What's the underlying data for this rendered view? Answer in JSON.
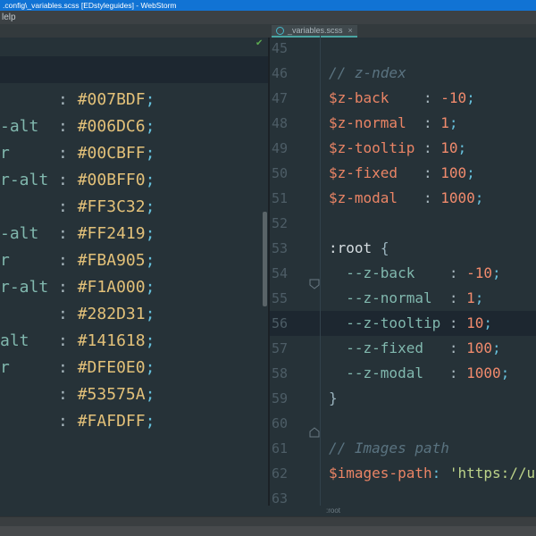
{
  "window": {
    "title": ".config\\_variables.scss [EDstyleguides] - WebStorm",
    "menu_fragment": "lelp"
  },
  "tab_bar": {
    "active_tab": {
      "label": "_variables.scss",
      "close_glyph": "×",
      "icon": "scss-file-icon"
    }
  },
  "left_editor": {
    "lines": [
      {
        "name": "",
        "colon": ":",
        "value": "#007BDF",
        "semi": ";"
      },
      {
        "name": "-alt",
        "colon": ":",
        "value": "#006DC6",
        "semi": ";"
      },
      {
        "name": "r",
        "colon": ":",
        "value": "#00CBFF",
        "semi": ";"
      },
      {
        "name": "r-alt",
        "colon": ":",
        "value": "#00BFF0",
        "semi": ";"
      },
      {
        "name": "",
        "colon": ":",
        "value": "#FF3C32",
        "semi": ";"
      },
      {
        "name": "-alt",
        "colon": ":",
        "value": "#FF2419",
        "semi": ";"
      },
      {
        "name": "r",
        "colon": ":",
        "value": "#FBA905",
        "semi": ";"
      },
      {
        "name": "r-alt",
        "colon": ":",
        "value": "#F1A000",
        "semi": ";"
      },
      {
        "name": "",
        "colon": ":",
        "value": "#282D31",
        "semi": ";"
      },
      {
        "name": "alt",
        "colon": ":",
        "value": "#141618",
        "semi": ";"
      },
      {
        "name": "r",
        "colon": ":",
        "value": "#DFE0E0",
        "semi": ";"
      },
      {
        "name": "",
        "colon": ":",
        "value": "#53575A",
        "semi": ";"
      },
      {
        "name": "",
        "colon": ":",
        "value": "#FAFDFF",
        "semi": ";"
      }
    ],
    "inspection_ok_glyph": "✔"
  },
  "right_editor": {
    "highlighted_line": "56",
    "fold_markers": [
      {
        "line": "53",
        "type": "open"
      },
      {
        "line": "59",
        "type": "close"
      }
    ],
    "breadcrumb": ":root",
    "lines": [
      {
        "num": "45",
        "tokens": []
      },
      {
        "num": "46",
        "tokens": [
          {
            "c": "comment",
            "t": "// z-ndex"
          }
        ]
      },
      {
        "num": "47",
        "tokens": [
          {
            "c": "var",
            "t": "$z-back"
          },
          {
            "c": "colon",
            "t": "    : "
          },
          {
            "c": "num",
            "t": "-10"
          },
          {
            "c": "semi",
            "t": ";"
          }
        ]
      },
      {
        "num": "48",
        "tokens": [
          {
            "c": "var",
            "t": "$z-normal"
          },
          {
            "c": "colon",
            "t": "  : "
          },
          {
            "c": "num",
            "t": "1"
          },
          {
            "c": "semi",
            "t": ";"
          }
        ]
      },
      {
        "num": "49",
        "tokens": [
          {
            "c": "var",
            "t": "$z-tooltip"
          },
          {
            "c": "colon",
            "t": " : "
          },
          {
            "c": "num",
            "t": "10"
          },
          {
            "c": "semi",
            "t": ";"
          }
        ]
      },
      {
        "num": "50",
        "tokens": [
          {
            "c": "var",
            "t": "$z-fixed"
          },
          {
            "c": "colon",
            "t": "   : "
          },
          {
            "c": "num",
            "t": "100"
          },
          {
            "c": "semi",
            "t": ";"
          }
        ]
      },
      {
        "num": "51",
        "tokens": [
          {
            "c": "var",
            "t": "$z-modal"
          },
          {
            "c": "colon",
            "t": "   : "
          },
          {
            "c": "num",
            "t": "1000"
          },
          {
            "c": "semi",
            "t": ";"
          }
        ]
      },
      {
        "num": "52",
        "tokens": []
      },
      {
        "num": "53",
        "tokens": [
          {
            "c": "selector",
            "t": ":root"
          },
          {
            "c": "plain",
            "t": " "
          },
          {
            "c": "brace",
            "t": "{"
          }
        ]
      },
      {
        "num": "54",
        "tokens": [
          {
            "c": "plain",
            "t": "  "
          },
          {
            "c": "prop",
            "t": "--z-back"
          },
          {
            "c": "colon",
            "t": "    : "
          },
          {
            "c": "num",
            "t": "-10"
          },
          {
            "c": "semi",
            "t": ";"
          }
        ]
      },
      {
        "num": "55",
        "tokens": [
          {
            "c": "plain",
            "t": "  "
          },
          {
            "c": "prop",
            "t": "--z-normal"
          },
          {
            "c": "colon",
            "t": "  : "
          },
          {
            "c": "num",
            "t": "1"
          },
          {
            "c": "semi",
            "t": ";"
          }
        ]
      },
      {
        "num": "56",
        "tokens": [
          {
            "c": "plain",
            "t": "  "
          },
          {
            "c": "prop",
            "t": "--z-tooltip"
          },
          {
            "c": "colon",
            "t": " : "
          },
          {
            "c": "num",
            "t": "10"
          },
          {
            "c": "semi",
            "t": ";"
          }
        ]
      },
      {
        "num": "57",
        "tokens": [
          {
            "c": "plain",
            "t": "  "
          },
          {
            "c": "prop",
            "t": "--z-fixed"
          },
          {
            "c": "colon",
            "t": "   : "
          },
          {
            "c": "num",
            "t": "100"
          },
          {
            "c": "semi",
            "t": ";"
          }
        ]
      },
      {
        "num": "58",
        "tokens": [
          {
            "c": "plain",
            "t": "  "
          },
          {
            "c": "prop",
            "t": "--z-modal"
          },
          {
            "c": "colon",
            "t": "   : "
          },
          {
            "c": "num",
            "t": "1000"
          },
          {
            "c": "semi",
            "t": ";"
          }
        ]
      },
      {
        "num": "59",
        "tokens": [
          {
            "c": "brace",
            "t": "}"
          }
        ]
      },
      {
        "num": "60",
        "tokens": []
      },
      {
        "num": "61",
        "tokens": [
          {
            "c": "comment",
            "t": "// Images path"
          }
        ]
      },
      {
        "num": "62",
        "tokens": [
          {
            "c": "var",
            "t": "$images-path"
          },
          {
            "c": "semi",
            "t": ": "
          },
          {
            "c": "string",
            "t": "'https://u"
          }
        ]
      },
      {
        "num": "63",
        "tokens": []
      }
    ]
  },
  "colors": {
    "titlebar": "#1173d4",
    "editor_bg": "#263238",
    "caret_row": "#1d2730",
    "gutter": "#4d5d66",
    "comment": "#5a7380",
    "var": "#ea8465",
    "num": "#f28b6d",
    "prop": "#81b8ae",
    "hex": "#e3c179",
    "colon": "#a8b7be",
    "semi": "#66bfda",
    "selector": "#d6dde1",
    "brace": "#9ab3bd",
    "string": "#bcd389"
  }
}
